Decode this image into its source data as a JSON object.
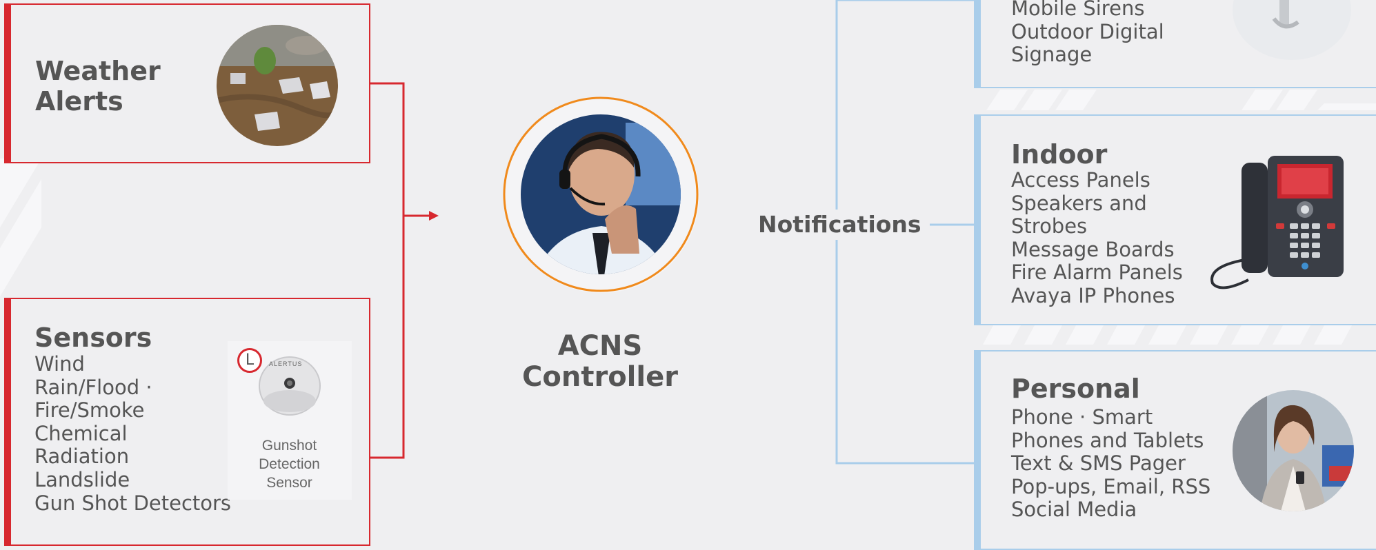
{
  "inputs": {
    "weather": {
      "title": "Weather Alerts",
      "image": "flooded-neighborhood-photo"
    },
    "sensors": {
      "title": "Sensors",
      "items": [
        "Wind",
        "Rain/Flood ·",
        "Fire/Smoke",
        "Chemical",
        "Radiation",
        "Landslide",
        "Gun Shot Detectors"
      ],
      "device_badge": "L",
      "device_brand": "ALERTUS",
      "device_caption": [
        "Gunshot",
        "Detection",
        "Sensor"
      ]
    }
  },
  "controller": {
    "label_line1": "ACNS",
    "label_line2": "Controller",
    "image": "operator-with-headset-photo"
  },
  "notifications": {
    "label": "Notifications",
    "outdoor": {
      "items": [
        "Mobile Sirens",
        "Outdoor Digital",
        "Signage"
      ],
      "image": "siren-device-photo"
    },
    "indoor": {
      "title": "Indoor",
      "items": [
        "Access Panels",
        "Speakers and",
        "Strobes",
        "Message Boards",
        "Fire Alarm Panels",
        "Avaya IP Phones"
      ],
      "image": "ip-desk-phone-photo"
    },
    "personal": {
      "title": "Personal",
      "items": [
        "Phone · Smart",
        "Phones and Tablets",
        "Text & SMS Pager",
        "Pop-ups, Email, RSS",
        "Social Media"
      ],
      "image": "woman-using-smartphone-photo"
    }
  },
  "colors": {
    "input_accent": "#d7282f",
    "output_accent": "#a9cdea",
    "controller_ring": "#f08a1c",
    "background": "#efeff1",
    "text": "#555555"
  }
}
